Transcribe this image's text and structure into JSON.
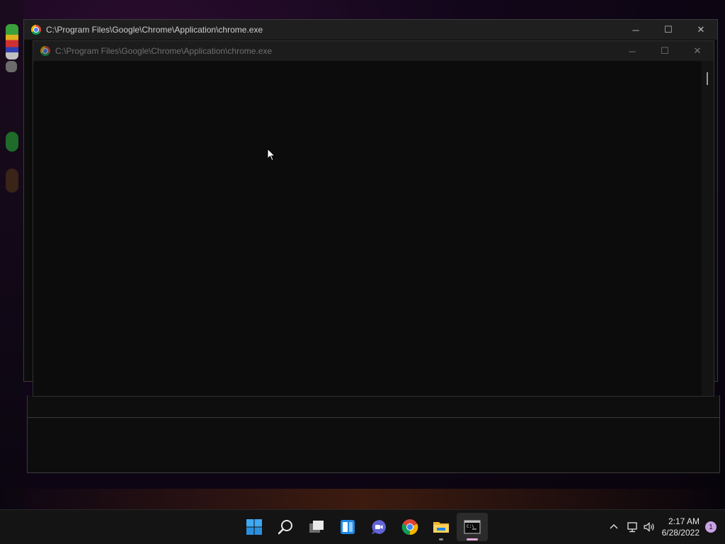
{
  "windows": {
    "back": {
      "title": "C:\\Program Files\\Google\\Chrome\\Application\\chrome.exe",
      "icon": "chrome-icon"
    },
    "front": {
      "title": "C:\\Program Files\\Google\\Chrome\\Application\\chrome.exe",
      "icon": "chrome-icon"
    },
    "controls": {
      "minimize": "─",
      "maximize": "☐",
      "close": "✕"
    }
  },
  "taskbar": {
    "apps": [
      {
        "name": "start",
        "icon": "windows-start-icon"
      },
      {
        "name": "search",
        "icon": "search-icon"
      },
      {
        "name": "task-view",
        "icon": "task-view-icon"
      },
      {
        "name": "widgets",
        "icon": "widgets-icon"
      },
      {
        "name": "chat",
        "icon": "teams-chat-icon"
      },
      {
        "name": "chrome",
        "icon": "chrome-icon"
      },
      {
        "name": "file-explorer",
        "icon": "folder-icon"
      },
      {
        "name": "terminal",
        "icon": "terminal-icon"
      }
    ],
    "tray": {
      "overflow_icon": "chevron-up-icon",
      "network_icon": "network-icon",
      "volume_icon": "volume-icon",
      "time": "2:17 AM",
      "date": "6/28/2022",
      "notification_count": "1"
    }
  },
  "colors": {
    "accent": "#0078d4",
    "taskbar_bg": "#141414",
    "console_bg": "#0c0c0c",
    "indicator_active": "#e4a6d8"
  }
}
